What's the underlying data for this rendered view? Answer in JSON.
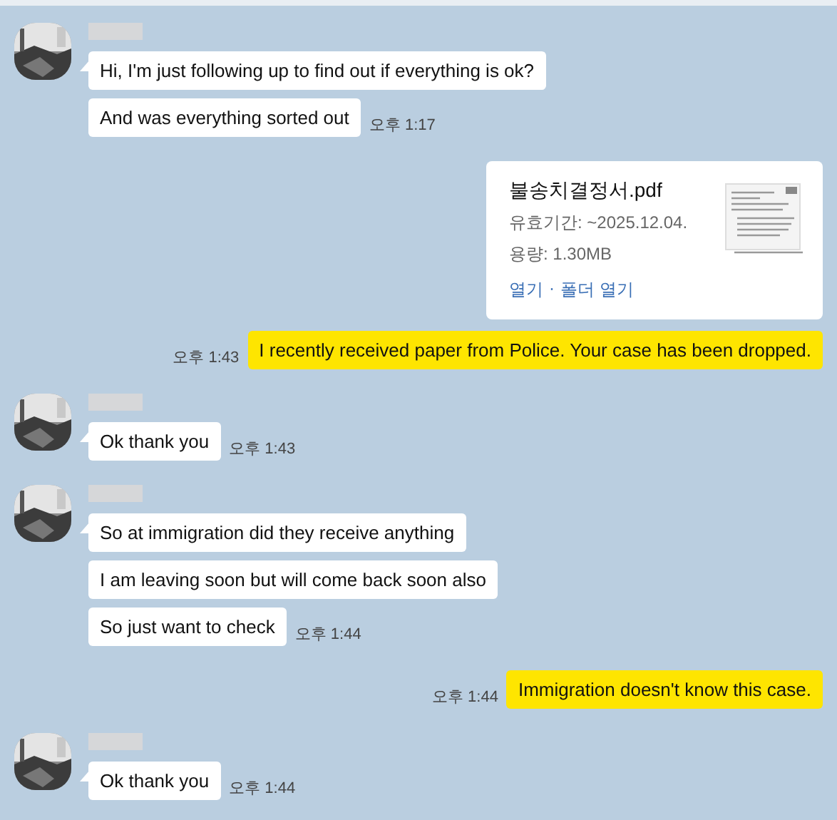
{
  "groups": [
    {
      "kind": "incoming",
      "messages": [
        "Hi, I'm just following up to find out if everything is ok?",
        "And was everything sorted out"
      ],
      "time": "오후 1:17"
    },
    {
      "kind": "outgoing",
      "file": {
        "name": "불송치결정서.pdf",
        "expiry": "유효기간: ~2025.12.04.",
        "size": "용량: 1.30MB",
        "open": "열기",
        "separator": "·",
        "open_folder": "폴더 열기"
      },
      "messages": [
        "I recently received paper from Police. Your case has been dropped."
      ],
      "time": "오후 1:43"
    },
    {
      "kind": "incoming",
      "messages": [
        "Ok thank you"
      ],
      "time": "오후 1:43"
    },
    {
      "kind": "incoming",
      "messages": [
        "So at immigration did they receive anything",
        "I am leaving soon but will come back soon also",
        "So just want to check"
      ],
      "time": "오후 1:44"
    },
    {
      "kind": "outgoing",
      "messages": [
        "Immigration doesn't know this case."
      ],
      "time": "오후 1:44"
    },
    {
      "kind": "incoming",
      "messages": [
        "Ok thank you"
      ],
      "time": "오후 1:44"
    }
  ]
}
